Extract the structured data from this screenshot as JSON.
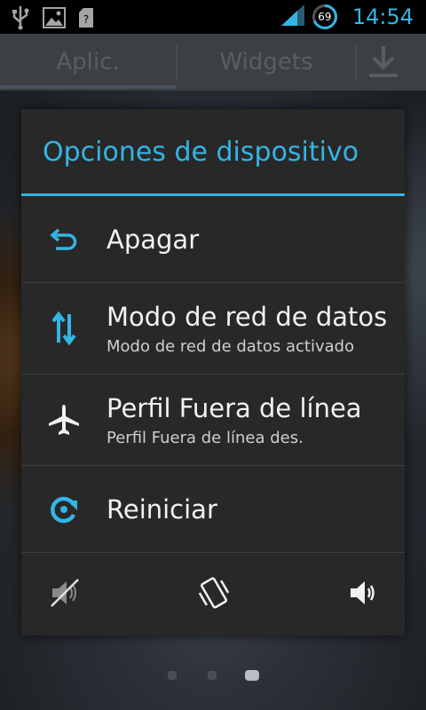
{
  "status_bar": {
    "icons": [
      "usb-icon",
      "image-icon",
      "sim-icon"
    ],
    "signal_icon": "signal-icon",
    "battery_level": "69",
    "time": "14:54"
  },
  "launcher": {
    "tabs": [
      "Aplic.",
      "Widgets"
    ],
    "store_icon": "download-icon",
    "page_count": 3,
    "active_page": 3
  },
  "dialog": {
    "title": "Opciones de dispositivo",
    "items": [
      {
        "icon": "power-off-icon",
        "label": "Apagar",
        "sub": ""
      },
      {
        "icon": "data-transfer-icon",
        "label": "Modo de red de datos",
        "sub": "Modo de red de datos activado"
      },
      {
        "icon": "airplane-icon",
        "label": "Perfil Fuera de línea",
        "sub": "Perfil Fuera de línea des."
      },
      {
        "icon": "restart-icon",
        "label": "Reiniciar",
        "sub": ""
      }
    ],
    "sound_modes": [
      "silent-mode-icon",
      "vibrate-mode-icon",
      "sound-on-icon"
    ]
  },
  "colors": {
    "accent": "#33b5e5",
    "dialog_bg": "#282828",
    "text": "#f2f2f2"
  }
}
